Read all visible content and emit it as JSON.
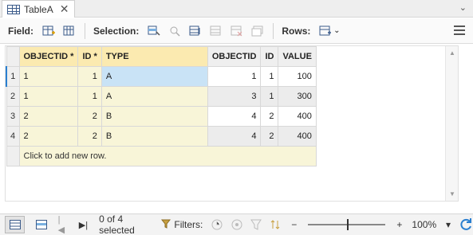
{
  "tab": {
    "title": "TableA",
    "close_glyph": "✕",
    "overflow_glyph": "⌄"
  },
  "toolbar": {
    "field_label": "Field:",
    "selection_label": "Selection:",
    "rows_label": "Rows:",
    "rows_dropdown_glyph": "⌄"
  },
  "grid": {
    "columns": [
      "OBJECTID *",
      "ID *",
      "TYPE",
      "OBJECTID",
      "ID",
      "VALUE"
    ],
    "rows": [
      {
        "num": "1",
        "cells": [
          "1",
          "1",
          "A",
          "1",
          "1",
          "100"
        ]
      },
      {
        "num": "2",
        "cells": [
          "1",
          "1",
          "A",
          "3",
          "1",
          "300"
        ]
      },
      {
        "num": "3",
        "cells": [
          "2",
          "2",
          "B",
          "4",
          "2",
          "400"
        ]
      },
      {
        "num": "4",
        "cells": [
          "2",
          "2",
          "B",
          "4",
          "2",
          "400"
        ]
      }
    ],
    "add_row_text": "Click to add new row."
  },
  "status": {
    "selected_text": "0 of 4 selected",
    "filters_label": "Filters:",
    "zoom_minus": "−",
    "zoom_plus": "+",
    "zoom_level": "100%",
    "zoom_level_fraction": 0.5,
    "zoom_dropdown_glyph": "▾"
  },
  "colors": {
    "accent_blue": "#2a7fd0",
    "left_table_header": "#fbeab0",
    "left_table_cell": "#f8f5d8",
    "selected_cell": "#c9e3f6"
  }
}
